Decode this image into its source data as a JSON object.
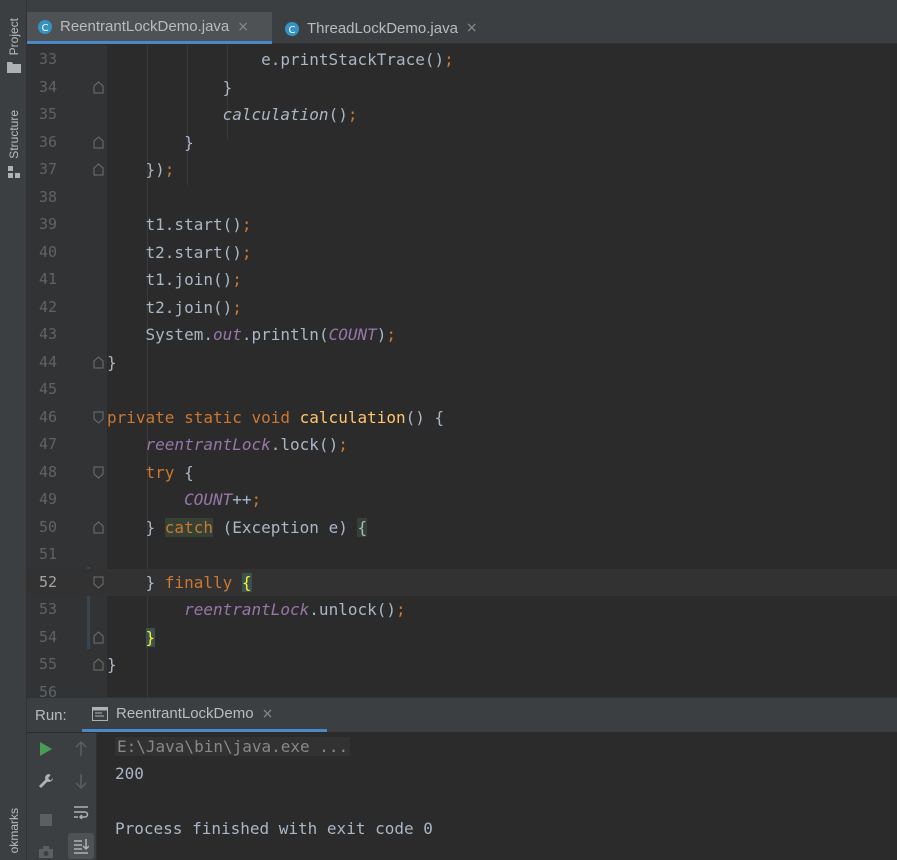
{
  "left_strip": {
    "project_label": "Project",
    "structure_label": "Structure",
    "bookmarks_label": "okmarks"
  },
  "tabs": [
    {
      "label": "ReentrantLockDemo.java",
      "active": true
    },
    {
      "label": "ThreadLockDemo.java",
      "active": false
    }
  ],
  "tab_close_glyph": "×",
  "editor": {
    "current_line": "52",
    "lines": [
      {
        "n": "33",
        "tokens": [
          {
            "t": "                e.printStackTrace()",
            "c": "plain"
          },
          {
            "t": ";",
            "c": "semi"
          }
        ]
      },
      {
        "n": "34",
        "tokens": [
          {
            "t": "            }",
            "c": "plain"
          }
        ]
      },
      {
        "n": "35",
        "tokens": [
          {
            "t": "            ",
            "c": "plain"
          },
          {
            "t": "calculation",
            "c": "italic-plain"
          },
          {
            "t": "()",
            "c": "plain"
          },
          {
            "t": ";",
            "c": "semi"
          }
        ]
      },
      {
        "n": "36",
        "tokens": [
          {
            "t": "        }",
            "c": "plain"
          }
        ]
      },
      {
        "n": "37",
        "tokens": [
          {
            "t": "    })",
            "c": "plain"
          },
          {
            "t": ";",
            "c": "semi"
          }
        ]
      },
      {
        "n": "38",
        "tokens": []
      },
      {
        "n": "39",
        "tokens": [
          {
            "t": "    t1.start()",
            "c": "plain"
          },
          {
            "t": ";",
            "c": "semi"
          }
        ]
      },
      {
        "n": "40",
        "tokens": [
          {
            "t": "    t2.start()",
            "c": "plain"
          },
          {
            "t": ";",
            "c": "semi"
          }
        ]
      },
      {
        "n": "41",
        "tokens": [
          {
            "t": "    t1.join()",
            "c": "plain"
          },
          {
            "t": ";",
            "c": "semi"
          }
        ]
      },
      {
        "n": "42",
        "tokens": [
          {
            "t": "    t2.join()",
            "c": "plain"
          },
          {
            "t": ";",
            "c": "semi"
          }
        ]
      },
      {
        "n": "43",
        "tokens": [
          {
            "t": "    System.",
            "c": "plain"
          },
          {
            "t": "out",
            "c": "st"
          },
          {
            "t": ".println(",
            "c": "plain"
          },
          {
            "t": "COUNT",
            "c": "st"
          },
          {
            "t": ")",
            "c": "plain"
          },
          {
            "t": ";",
            "c": "semi"
          }
        ]
      },
      {
        "n": "44",
        "tokens": [
          {
            "t": "}",
            "c": "plain"
          }
        ]
      },
      {
        "n": "45",
        "tokens": []
      },
      {
        "n": "46",
        "tokens": [
          {
            "t": "private static void ",
            "c": "kw"
          },
          {
            "t": "calculation",
            "c": "fn"
          },
          {
            "t": "() {",
            "c": "plain"
          }
        ]
      },
      {
        "n": "47",
        "tokens": [
          {
            "t": "    ",
            "c": "plain"
          },
          {
            "t": "reentrantLock",
            "c": "st"
          },
          {
            "t": ".lock()",
            "c": "plain"
          },
          {
            "t": ";",
            "c": "semi"
          }
        ]
      },
      {
        "n": "48",
        "tokens": [
          {
            "t": "    ",
            "c": "plain"
          },
          {
            "t": "try",
            "c": "kw"
          },
          {
            "t": " {",
            "c": "plain"
          }
        ]
      },
      {
        "n": "49",
        "tokens": [
          {
            "t": "        ",
            "c": "plain"
          },
          {
            "t": "COUNT",
            "c": "st"
          },
          {
            "t": "++",
            "c": "plain"
          },
          {
            "t": ";",
            "c": "semi"
          }
        ]
      },
      {
        "n": "50",
        "tokens": [
          {
            "t": "    } ",
            "c": "plain"
          },
          {
            "t": "catch",
            "c": "kw-hl"
          },
          {
            "t": " (Exception e) ",
            "c": "plain"
          },
          {
            "t": "{",
            "c": "plain-hl"
          }
        ]
      },
      {
        "n": "51",
        "tokens": []
      },
      {
        "n": "52",
        "tokens": [
          {
            "t": "    } ",
            "c": "plain"
          },
          {
            "t": "finally",
            "c": "kw"
          },
          {
            "t": " ",
            "c": "plain"
          },
          {
            "t": "{",
            "c": "brk-hl"
          }
        ]
      },
      {
        "n": "53",
        "tokens": [
          {
            "t": "        ",
            "c": "plain"
          },
          {
            "t": "reentrantLock",
            "c": "st"
          },
          {
            "t": ".unlock()",
            "c": "plain"
          },
          {
            "t": ";",
            "c": "semi"
          }
        ]
      },
      {
        "n": "54",
        "tokens": [
          {
            "t": "    ",
            "c": "plain"
          },
          {
            "t": "}",
            "c": "brk-hl"
          }
        ]
      },
      {
        "n": "55",
        "tokens": [
          {
            "t": "}",
            "c": "plain"
          }
        ]
      },
      {
        "n": "56",
        "tokens": []
      }
    ]
  },
  "run": {
    "label": "Run:",
    "tab_label": "ReentrantLockDemo",
    "console_lines": [
      {
        "text": "E:\\Java\\bin\\java.exe ...",
        "kind": "cmd"
      },
      {
        "text": "200",
        "kind": "out"
      },
      {
        "text": "",
        "kind": "out"
      },
      {
        "text": "Process finished with exit code 0",
        "kind": "out"
      }
    ]
  },
  "colors": {
    "keyword": "#cc7832",
    "function": "#ffc66d",
    "static_field": "#9876aa",
    "text": "#a9b7c6",
    "accent_tab": "#4a88c7",
    "run_green": "#499c54"
  }
}
